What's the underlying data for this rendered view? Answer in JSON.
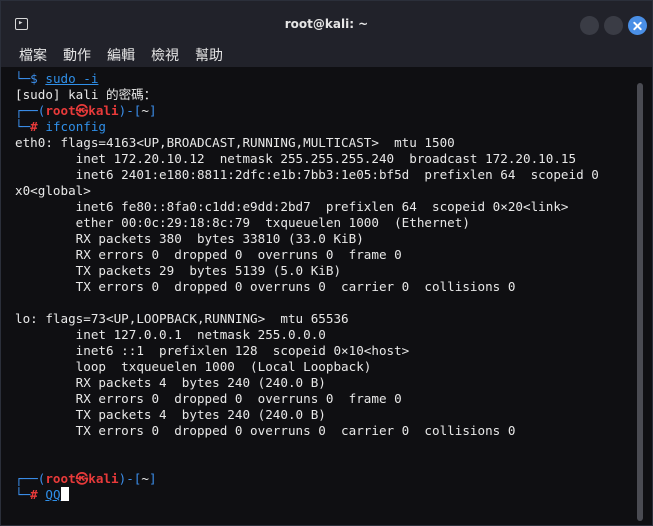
{
  "window": {
    "title": "root@kali: ~",
    "app_icon": "terminal-icon",
    "app_icon_glyph": "▸",
    "buttons": [
      "minimize-button",
      "maximize-button",
      "close-button"
    ]
  },
  "menu": [
    "檔案",
    "動作",
    "編輯",
    "檢視",
    "幫助"
  ],
  "terminal": {
    "line1_prefix": "└─",
    "line1_dollar": "$",
    "line1_cmd": "sudo -i",
    "line2": "[sudo] kali 的密碼：",
    "prompt1": {
      "lead": "┌──(",
      "user_host": "root㉿kali",
      "mid": ")-[",
      "path": "~",
      "tail": "]",
      "lead2": "└─",
      "hash": "#",
      "cmd": "ifconfig"
    },
    "output": [
      "eth0: flags=4163<UP,BROADCAST,RUNNING,MULTICAST>  mtu 1500",
      "        inet 172.20.10.12  netmask 255.255.255.240  broadcast 172.20.10.15",
      "        inet6 2401:e180:8811:2dfc:e1b:7bb3:1e05:bf5d  prefixlen 64  scopeid 0",
      "x0<global>",
      "        inet6 fe80::8fa0:c1dd:e9dd:2bd7  prefixlen 64  scopeid 0×20<link>",
      "        ether 00:0c:29:18:8c:79  txqueuelen 1000  (Ethernet)",
      "        RX packets 380  bytes 33810 (33.0 KiB)",
      "        RX errors 0  dropped 0  overruns 0  frame 0",
      "        TX packets 29  bytes 5139 (5.0 KiB)",
      "        TX errors 0  dropped 0 overruns 0  carrier 0  collisions 0",
      "",
      "lo: flags=73<UP,LOOPBACK,RUNNING>  mtu 65536",
      "        inet 127.0.0.1  netmask 255.0.0.0",
      "        inet6 ::1  prefixlen 128  scopeid 0×10<host>",
      "        loop  txqueuelen 1000  (Local Loopback)",
      "        RX packets 4  bytes 240 (240.0 B)",
      "        RX errors 0  dropped 0  overruns 0  frame 0",
      "        TX packets 4  bytes 240 (240.0 B)",
      "        TX errors 0  dropped 0 overruns 0  carrier 0  collisions 0"
    ],
    "prompt2": {
      "lead": "┌──(",
      "user_host": "root㉿kali",
      "mid": ")-[",
      "path": "~",
      "tail": "]",
      "lead2": "└─",
      "hash": "#",
      "input": "QQ"
    }
  },
  "colors": {
    "prompt_frame": "#3b8eea",
    "prompt_user": "#e83a3a",
    "command": "#2f8fe8",
    "background": "#0f0f12"
  }
}
